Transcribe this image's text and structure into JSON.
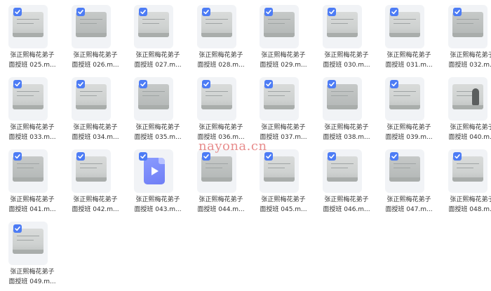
{
  "watermark": "nayona.cn",
  "accent_color": "#4d7cf5",
  "files": [
    {
      "line1": "张正熙梅花弟子",
      "line2": "面授班 025.m...",
      "selected": true,
      "thumb": "board"
    },
    {
      "line1": "张正熙梅花弟子",
      "line2": "面授班 026.m...",
      "selected": true,
      "thumb": "board"
    },
    {
      "line1": "张正熙梅花弟子",
      "line2": "面授班 027.m...",
      "selected": true,
      "thumb": "board"
    },
    {
      "line1": "张正熙梅花弟子",
      "line2": "面授班 028.m...",
      "selected": true,
      "thumb": "board"
    },
    {
      "line1": "张正熙梅花弟子",
      "line2": "面授班 029.m...",
      "selected": true,
      "thumb": "board"
    },
    {
      "line1": "张正熙梅花弟子",
      "line2": "面授班 030.m...",
      "selected": true,
      "thumb": "board"
    },
    {
      "line1": "张正熙梅花弟子",
      "line2": "面授班 031.m...",
      "selected": true,
      "thumb": "board"
    },
    {
      "line1": "张正熙梅花弟子",
      "line2": "面授班 032.m...",
      "selected": true,
      "thumb": "board"
    },
    {
      "line1": "张正熙梅花弟子",
      "line2": "面授班 033.m...",
      "selected": true,
      "thumb": "board"
    },
    {
      "line1": "张正熙梅花弟子",
      "line2": "面授班 034.m...",
      "selected": true,
      "thumb": "board"
    },
    {
      "line1": "张正熙梅花弟子",
      "line2": "面授班 035.m...",
      "selected": true,
      "thumb": "board"
    },
    {
      "line1": "张正熙梅花弟子",
      "line2": "面授班 036.m...",
      "selected": true,
      "thumb": "board"
    },
    {
      "line1": "张正熙梅花弟子",
      "line2": "面授班 037.m...",
      "selected": true,
      "thumb": "board"
    },
    {
      "line1": "张正熙梅花弟子",
      "line2": "面授班 038.m...",
      "selected": true,
      "thumb": "board"
    },
    {
      "line1": "张正熙梅花弟子",
      "line2": "面授班 039.m...",
      "selected": true,
      "thumb": "board"
    },
    {
      "line1": "张正熙梅花弟子",
      "line2": "面授班 040.m...",
      "selected": false,
      "thumb": "person"
    },
    {
      "line1": "张正熙梅花弟子",
      "line2": "面授班 041.m...",
      "selected": true,
      "thumb": "board"
    },
    {
      "line1": "张正熙梅花弟子",
      "line2": "面授班 042.m...",
      "selected": true,
      "thumb": "board"
    },
    {
      "line1": "张正熙梅花弟子",
      "line2": "面授班 043.m...",
      "selected": true,
      "thumb": "video-icon"
    },
    {
      "line1": "张正熙梅花弟子",
      "line2": "面授班 044.m...",
      "selected": true,
      "thumb": "board"
    },
    {
      "line1": "张正熙梅花弟子",
      "line2": "面授班 045.m...",
      "selected": true,
      "thumb": "board"
    },
    {
      "line1": "张正熙梅花弟子",
      "line2": "面授班 046.m...",
      "selected": true,
      "thumb": "board"
    },
    {
      "line1": "张正熙梅花弟子",
      "line2": "面授班 047.m...",
      "selected": true,
      "thumb": "board"
    },
    {
      "line1": "张正熙梅花弟子",
      "line2": "面授班 048.m...",
      "selected": true,
      "thumb": "board"
    },
    {
      "line1": "张正熙梅花弟子",
      "line2": "面授班 049.m...",
      "selected": true,
      "thumb": "board"
    }
  ]
}
